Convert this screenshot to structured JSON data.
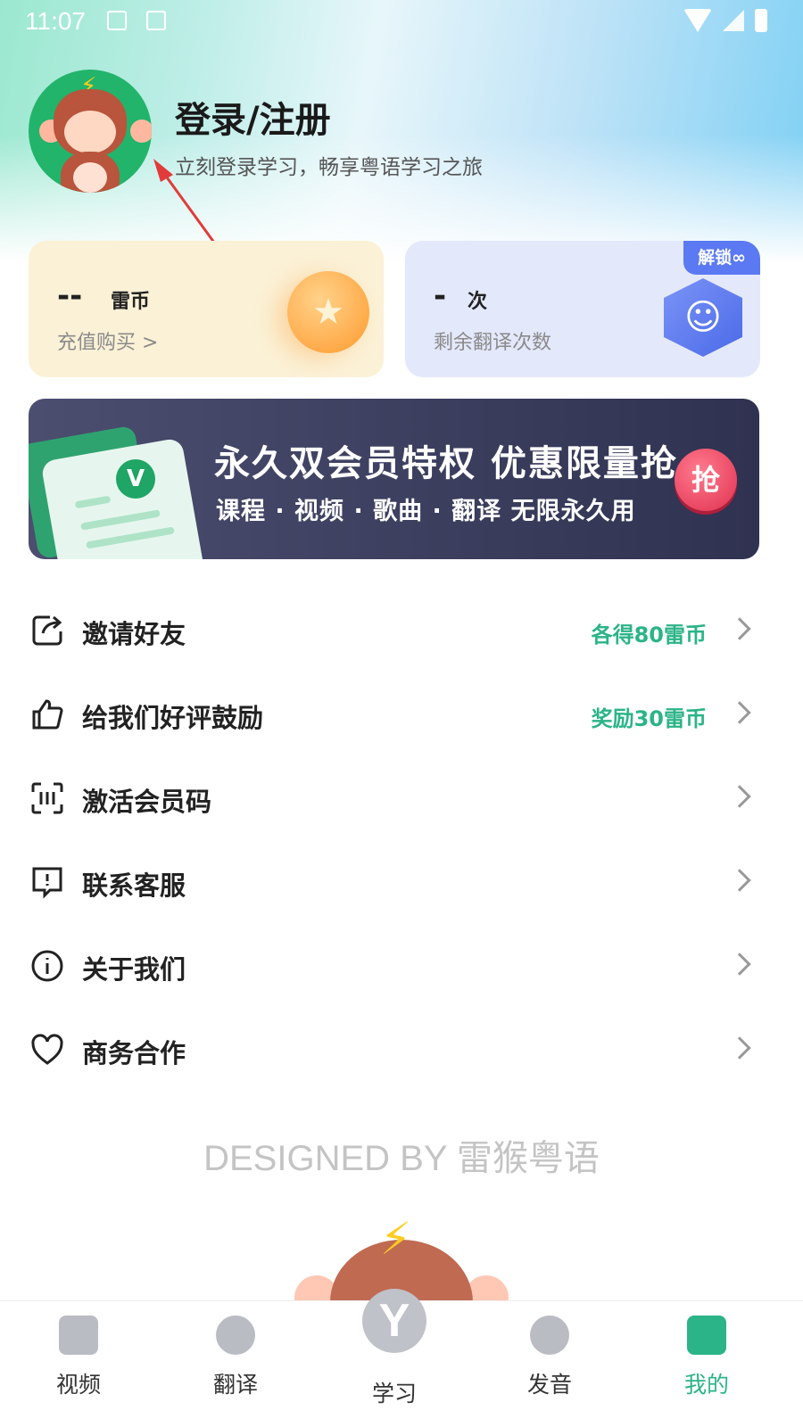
{
  "status_bar": {
    "time": "11:07"
  },
  "profile": {
    "title": "登录/注册",
    "subtitle": "立刻登录学习，畅享粤语学习之旅"
  },
  "cards": {
    "coin": {
      "value": "--",
      "unit": "雷币",
      "sub": "充值购买 >"
    },
    "translate": {
      "value": "-",
      "unit": "次",
      "sub": "剩余翻译次数",
      "tag": "解锁∞"
    }
  },
  "banner": {
    "title": "永久双会员特权 优惠限量抢",
    "subtitle": "课程 · 视频 · 歌曲 · 翻译 无限永久用",
    "button": "抢"
  },
  "menu": [
    {
      "label": "邀请好友",
      "reward": "各得80雷币",
      "icon": "share-icon"
    },
    {
      "label": "给我们好评鼓励",
      "reward": "奖励30雷币",
      "icon": "thumbs-up-icon"
    },
    {
      "label": "激活会员码",
      "reward": "",
      "icon": "scan-code-icon"
    },
    {
      "label": "联系客服",
      "reward": "",
      "icon": "chat-icon"
    },
    {
      "label": "关于我们",
      "reward": "",
      "icon": "info-icon"
    },
    {
      "label": "商务合作",
      "reward": "",
      "icon": "heart-icon"
    }
  ],
  "footer": {
    "designed_by": "DESIGNED BY 雷猴粤语"
  },
  "tabs": [
    {
      "label": "视频",
      "icon": "video-icon"
    },
    {
      "label": "翻译",
      "icon": "translate-icon"
    },
    {
      "label": "学习",
      "icon": "learn-icon"
    },
    {
      "label": "发音",
      "icon": "pronunciation-icon"
    },
    {
      "label": "我的",
      "icon": "profile-icon",
      "active": true
    }
  ],
  "colors": {
    "accent": "#2bb487",
    "banner_bg": "#3a3c5e",
    "tag_blue": "#5b79f2"
  }
}
